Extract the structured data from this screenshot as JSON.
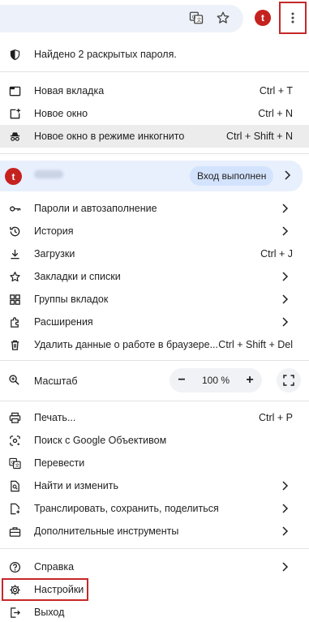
{
  "toolbar": {
    "avatar_letter": "t",
    "icons": [
      "translate-icon",
      "star-icon",
      "kebab-menu-icon"
    ]
  },
  "menu": {
    "password_alert": "Найдено 2 раскрытых пароля.",
    "new_tab": {
      "label": "Новая вкладка",
      "shortcut": "Ctrl + T"
    },
    "new_window": {
      "label": "Новое окно",
      "shortcut": "Ctrl + N"
    },
    "incognito": {
      "label": "Новое окно в режиме инкогнито",
      "shortcut": "Ctrl + Shift + N"
    },
    "profile": {
      "avatar_letter": "t",
      "name": "tiffany",
      "status": "Вход выполнен"
    },
    "passwords": {
      "label": "Пароли и автозаполнение"
    },
    "history": {
      "label": "История"
    },
    "downloads": {
      "label": "Загрузки",
      "shortcut": "Ctrl + J"
    },
    "bookmarks": {
      "label": "Закладки и списки"
    },
    "tab_groups": {
      "label": "Группы вкладок"
    },
    "extensions": {
      "label": "Расширения"
    },
    "clear_data": {
      "label": "Удалить данные о работе в браузере...",
      "shortcut": "Ctrl + Shift + Del"
    },
    "zoom": {
      "label": "Масштаб",
      "minus": "−",
      "value": "100 %",
      "plus": "+"
    },
    "print": {
      "label": "Печать...",
      "shortcut": "Ctrl + P"
    },
    "lens": {
      "label": "Поиск с Google Объективом"
    },
    "translate": {
      "label": "Перевести"
    },
    "find": {
      "label": "Найти и изменить"
    },
    "cast": {
      "label": "Транслировать, сохранить, поделиться"
    },
    "more_tools": {
      "label": "Дополнительные инструменты"
    },
    "help": {
      "label": "Справка"
    },
    "settings": {
      "label": "Настройки"
    },
    "exit": {
      "label": "Выход"
    }
  },
  "colors": {
    "highlight_box": "#c62828",
    "profile_bg": "#e8effd",
    "profile_badge_bg": "#d3e3fd",
    "avatar": "#c5221f"
  }
}
